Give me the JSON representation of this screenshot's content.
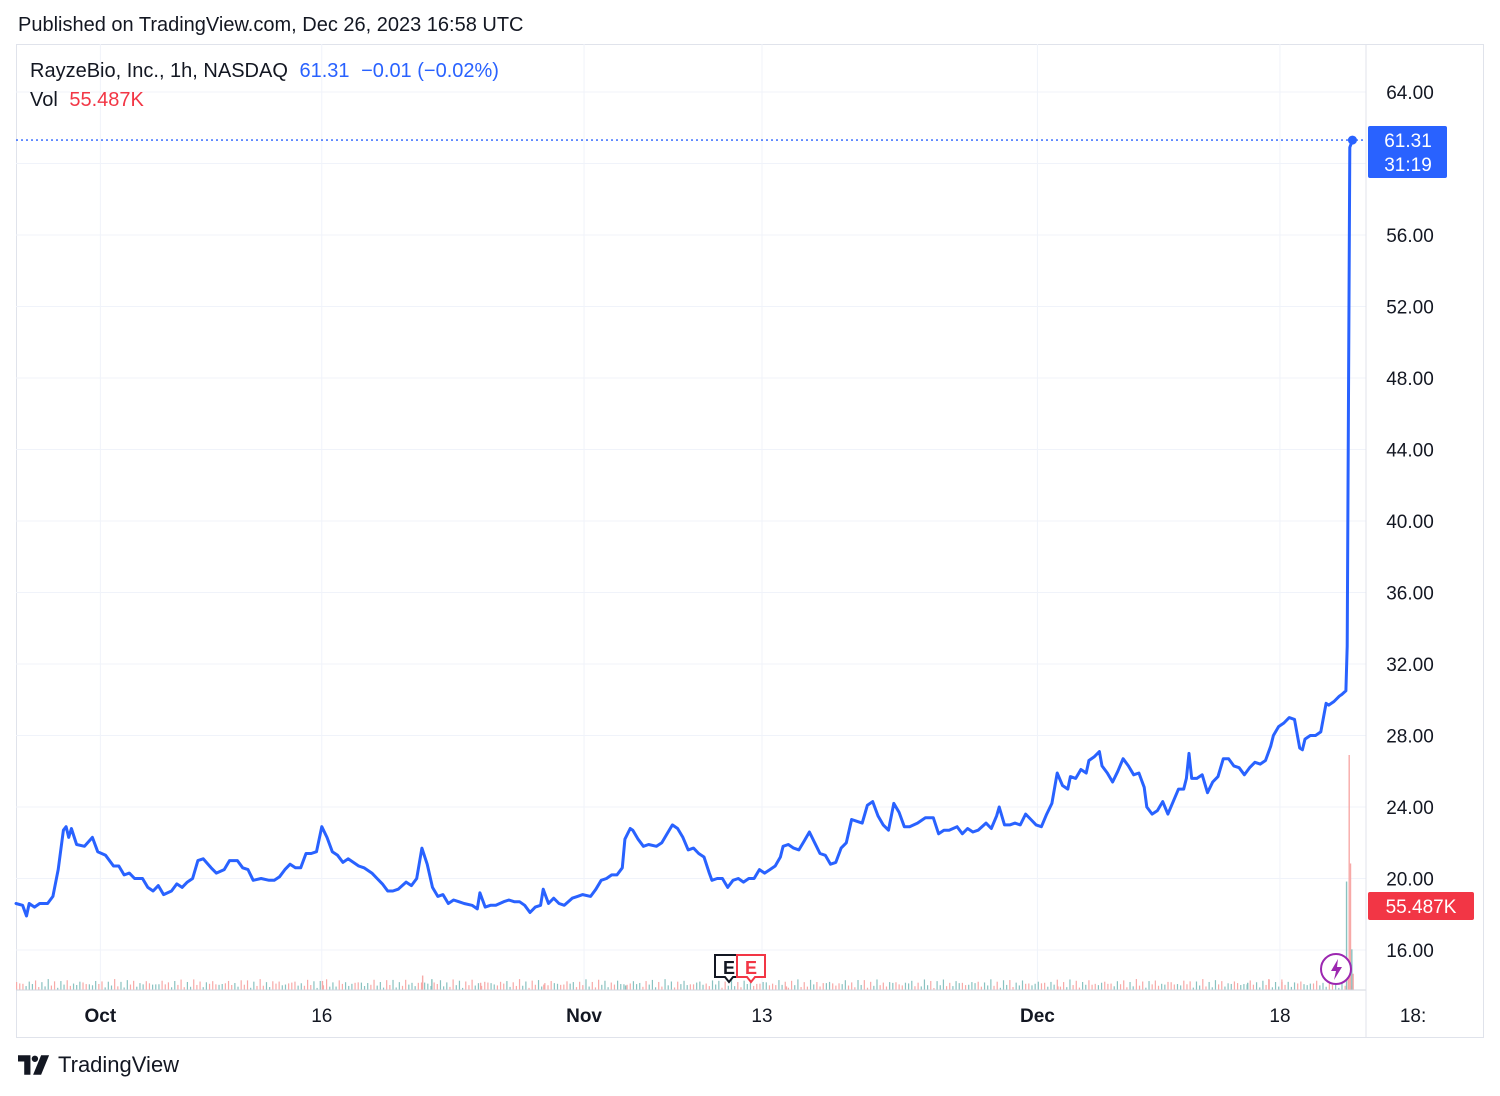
{
  "header": {
    "published": "Published on TradingView.com, Dec 26, 2023 16:58 UTC"
  },
  "legend": {
    "symbol": "RayzeBio, Inc., 1h, NASDAQ",
    "last": "61.31",
    "change": "−0.01 (−0.02%)",
    "vol_label": "Vol",
    "vol_value": "55.487K"
  },
  "price_tag": {
    "price": "61.31",
    "countdown": "31:19"
  },
  "volume_tag": "55.487K",
  "events": {
    "earnings_1": "E",
    "earnings_2": "E"
  },
  "footer": {
    "brand": "TradingView"
  },
  "colors": {
    "line": "#2962ff",
    "volume_up": "#89c2c0",
    "volume_down": "#f7a9a7",
    "grid": "#f0f3fa",
    "volume_tag": "#f23645",
    "dividend": "#9c27b0"
  },
  "chart_data": {
    "type": "line",
    "y_axis": {
      "range": [
        13.5,
        66.5
      ],
      "ticks": [
        16,
        20,
        24,
        28,
        32,
        36,
        40,
        44,
        48,
        52,
        56,
        60,
        64
      ],
      "tick_labels": [
        "16.00",
        "20.00",
        "24.00",
        "28.00",
        "32.00",
        "36.00",
        "40.00",
        "44.00",
        "48.00",
        "52.00",
        "56.00",
        "",
        "64.00"
      ]
    },
    "x_axis": {
      "range": [
        0,
        1000
      ],
      "ticks": [
        {
          "x": 64,
          "label": "Oct",
          "bold": true
        },
        {
          "x": 232,
          "label": "16",
          "bold": false
        },
        {
          "x": 431,
          "label": "Nov",
          "bold": true
        },
        {
          "x": 566,
          "label": "13",
          "bold": false
        },
        {
          "x": 775,
          "label": "Dec",
          "bold": true
        },
        {
          "x": 959,
          "label": "18",
          "bold": false
        },
        {
          "x": 1060,
          "label": "18:",
          "bold": false
        }
      ]
    },
    "series": [
      {
        "values": [
          [
            0,
            18.6
          ],
          [
            5,
            18.5
          ],
          [
            8,
            17.9
          ],
          [
            10,
            18.6
          ],
          [
            14,
            18.4
          ],
          [
            18,
            18.6
          ],
          [
            24,
            18.6
          ],
          [
            28,
            19.0
          ],
          [
            32,
            20.5
          ],
          [
            36,
            22.7
          ],
          [
            38,
            22.9
          ],
          [
            40,
            22.3
          ],
          [
            42,
            22.8
          ],
          [
            46,
            21.9
          ],
          [
            52,
            21.8
          ],
          [
            58,
            22.3
          ],
          [
            62,
            21.5
          ],
          [
            68,
            21.3
          ],
          [
            74,
            20.7
          ],
          [
            78,
            20.7
          ],
          [
            82,
            20.2
          ],
          [
            86,
            20.3
          ],
          [
            90,
            20.0
          ],
          [
            96,
            20.0
          ],
          [
            100,
            19.5
          ],
          [
            104,
            19.3
          ],
          [
            108,
            19.6
          ],
          [
            112,
            19.1
          ],
          [
            118,
            19.3
          ],
          [
            122,
            19.7
          ],
          [
            126,
            19.5
          ],
          [
            130,
            19.8
          ],
          [
            134,
            20.0
          ],
          [
            138,
            21.0
          ],
          [
            142,
            21.1
          ],
          [
            148,
            20.6
          ],
          [
            152,
            20.3
          ],
          [
            158,
            20.5
          ],
          [
            162,
            21.0
          ],
          [
            168,
            21.0
          ],
          [
            172,
            20.6
          ],
          [
            176,
            20.5
          ],
          [
            180,
            19.9
          ],
          [
            186,
            20.0
          ],
          [
            192,
            19.9
          ],
          [
            196,
            19.9
          ],
          [
            200,
            20.1
          ],
          [
            204,
            20.5
          ],
          [
            208,
            20.8
          ],
          [
            212,
            20.6
          ],
          [
            216,
            20.6
          ],
          [
            220,
            21.4
          ],
          [
            224,
            21.4
          ],
          [
            228,
            21.5
          ],
          [
            232,
            22.9
          ],
          [
            236,
            22.3
          ],
          [
            240,
            21.5
          ],
          [
            244,
            21.3
          ],
          [
            248,
            20.9
          ],
          [
            252,
            21.1
          ],
          [
            256,
            20.9
          ],
          [
            260,
            20.7
          ],
          [
            264,
            20.6
          ],
          [
            270,
            20.3
          ],
          [
            274,
            20.0
          ],
          [
            278,
            19.7
          ],
          [
            282,
            19.3
          ],
          [
            286,
            19.3
          ],
          [
            290,
            19.4
          ],
          [
            296,
            19.8
          ],
          [
            300,
            19.6
          ],
          [
            304,
            20.0
          ],
          [
            308,
            21.7
          ],
          [
            312,
            20.8
          ],
          [
            316,
            19.5
          ],
          [
            320,
            19.0
          ],
          [
            324,
            19.1
          ],
          [
            328,
            18.6
          ],
          [
            332,
            18.8
          ],
          [
            336,
            18.7
          ],
          [
            340,
            18.6
          ],
          [
            346,
            18.5
          ],
          [
            350,
            18.3
          ],
          [
            352,
            19.2
          ],
          [
            356,
            18.4
          ],
          [
            360,
            18.5
          ],
          [
            364,
            18.5
          ],
          [
            370,
            18.7
          ],
          [
            374,
            18.8
          ],
          [
            378,
            18.7
          ],
          [
            382,
            18.7
          ],
          [
            386,
            18.5
          ],
          [
            390,
            18.1
          ],
          [
            394,
            18.4
          ],
          [
            398,
            18.5
          ],
          [
            400,
            19.4
          ],
          [
            404,
            18.6
          ],
          [
            408,
            18.9
          ],
          [
            412,
            18.6
          ],
          [
            416,
            18.5
          ],
          [
            422,
            18.9
          ],
          [
            426,
            19.0
          ],
          [
            430,
            19.1
          ],
          [
            436,
            19.0
          ],
          [
            440,
            19.4
          ],
          [
            444,
            19.9
          ],
          [
            448,
            20.0
          ],
          [
            452,
            20.2
          ],
          [
            456,
            20.2
          ],
          [
            460,
            20.6
          ],
          [
            462,
            22.2
          ],
          [
            466,
            22.8
          ],
          [
            468,
            22.7
          ],
          [
            472,
            22.2
          ],
          [
            476,
            21.8
          ],
          [
            480,
            21.9
          ],
          [
            486,
            21.8
          ],
          [
            490,
            22.0
          ],
          [
            494,
            22.5
          ],
          [
            498,
            23.0
          ],
          [
            502,
            22.8
          ],
          [
            506,
            22.3
          ],
          [
            510,
            21.6
          ],
          [
            514,
            21.7
          ],
          [
            518,
            21.4
          ],
          [
            522,
            21.2
          ],
          [
            526,
            20.3
          ],
          [
            528,
            19.9
          ],
          [
            532,
            20.0
          ],
          [
            536,
            20.0
          ],
          [
            540,
            19.5
          ],
          [
            544,
            19.9
          ],
          [
            548,
            20.0
          ],
          [
            552,
            19.8
          ],
          [
            556,
            20.0
          ],
          [
            560,
            20.0
          ],
          [
            564,
            20.5
          ],
          [
            568,
            20.3
          ],
          [
            572,
            20.5
          ],
          [
            576,
            20.7
          ],
          [
            580,
            21.2
          ],
          [
            582,
            21.8
          ],
          [
            586,
            21.9
          ],
          [
            590,
            21.7
          ],
          [
            594,
            21.6
          ],
          [
            598,
            22.1
          ],
          [
            602,
            22.6
          ],
          [
            606,
            22.0
          ],
          [
            610,
            21.4
          ],
          [
            614,
            21.3
          ],
          [
            618,
            20.8
          ],
          [
            622,
            20.9
          ],
          [
            626,
            21.7
          ],
          [
            630,
            22.0
          ],
          [
            634,
            23.3
          ],
          [
            638,
            23.2
          ],
          [
            642,
            23.1
          ],
          [
            646,
            24.1
          ],
          [
            650,
            24.3
          ],
          [
            654,
            23.5
          ],
          [
            658,
            23.0
          ],
          [
            662,
            22.7
          ],
          [
            666,
            24.2
          ],
          [
            670,
            23.7
          ],
          [
            674,
            22.9
          ],
          [
            678,
            22.9
          ],
          [
            684,
            23.1
          ],
          [
            690,
            23.4
          ],
          [
            696,
            23.4
          ],
          [
            700,
            22.5
          ],
          [
            704,
            22.7
          ],
          [
            708,
            22.7
          ],
          [
            714,
            22.9
          ],
          [
            718,
            22.5
          ],
          [
            722,
            22.8
          ],
          [
            726,
            22.6
          ],
          [
            730,
            22.7
          ],
          [
            736,
            23.1
          ],
          [
            740,
            22.8
          ],
          [
            744,
            23.5
          ],
          [
            746,
            24.0
          ],
          [
            750,
            23.0
          ],
          [
            754,
            23.0
          ],
          [
            758,
            23.1
          ],
          [
            762,
            23.0
          ],
          [
            766,
            23.6
          ],
          [
            770,
            23.3
          ],
          [
            774,
            23.0
          ],
          [
            778,
            22.9
          ],
          [
            782,
            23.6
          ],
          [
            786,
            24.2
          ],
          [
            790,
            25.9
          ],
          [
            794,
            25.2
          ],
          [
            798,
            25.0
          ],
          [
            800,
            25.7
          ],
          [
            804,
            25.6
          ],
          [
            808,
            26.1
          ],
          [
            812,
            25.9
          ],
          [
            814,
            26.6
          ],
          [
            818,
            26.8
          ],
          [
            822,
            27.1
          ],
          [
            824,
            26.3
          ],
          [
            828,
            25.9
          ],
          [
            832,
            25.4
          ],
          [
            836,
            26.0
          ],
          [
            840,
            26.7
          ],
          [
            844,
            26.3
          ],
          [
            848,
            25.8
          ],
          [
            852,
            25.9
          ],
          [
            856,
            25.1
          ],
          [
            858,
            24.0
          ],
          [
            862,
            23.6
          ],
          [
            866,
            23.8
          ],
          [
            870,
            24.3
          ],
          [
            874,
            23.6
          ],
          [
            878,
            24.3
          ],
          [
            882,
            25.0
          ],
          [
            886,
            25.0
          ],
          [
            888,
            25.6
          ],
          [
            890,
            27.0
          ],
          [
            892,
            25.6
          ],
          [
            896,
            25.6
          ],
          [
            900,
            25.8
          ],
          [
            904,
            24.8
          ],
          [
            908,
            25.4
          ],
          [
            912,
            25.7
          ],
          [
            916,
            26.7
          ],
          [
            920,
            26.7
          ],
          [
            924,
            26.3
          ],
          [
            928,
            26.2
          ],
          [
            932,
            25.8
          ],
          [
            936,
            26.2
          ],
          [
            940,
            26.5
          ],
          [
            944,
            26.4
          ],
          [
            948,
            26.6
          ],
          [
            952,
            27.4
          ],
          [
            954,
            28.0
          ],
          [
            958,
            28.5
          ],
          [
            962,
            28.7
          ],
          [
            966,
            29.0
          ],
          [
            970,
            28.9
          ],
          [
            974,
            27.3
          ],
          [
            976,
            27.2
          ],
          [
            978,
            27.8
          ],
          [
            982,
            28.0
          ],
          [
            986,
            28.0
          ],
          [
            990,
            28.2
          ],
          [
            994,
            29.8
          ],
          [
            996,
            29.7
          ],
          [
            1000,
            29.9
          ],
          [
            1004,
            30.2
          ],
          [
            1006,
            30.3
          ],
          [
            1009,
            30.5
          ],
          [
            1010,
            33.0
          ],
          [
            1011,
            47.0
          ],
          [
            1012,
            60.9
          ],
          [
            1014,
            61.31
          ]
        ]
      }
    ],
    "volume": {
      "values": [
        [
          232,
          1.0
        ],
        [
          308,
          1.6
        ],
        [
          315,
          1.2
        ],
        [
          352,
          0.8
        ],
        [
          400,
          0.6
        ],
        [
          462,
          0.5
        ],
        [
          584,
          0.4
        ],
        [
          790,
          0.4
        ],
        [
          934,
          0.8
        ],
        [
          950,
          1.2
        ],
        [
          960,
          0.9
        ],
        [
          1009,
          12.0
        ],
        [
          1011,
          26.0
        ],
        [
          1012,
          14.0
        ],
        [
          1013,
          4.5
        ],
        [
          1014,
          1.8
        ]
      ],
      "max": 26
    },
    "last_price": 61.31
  }
}
